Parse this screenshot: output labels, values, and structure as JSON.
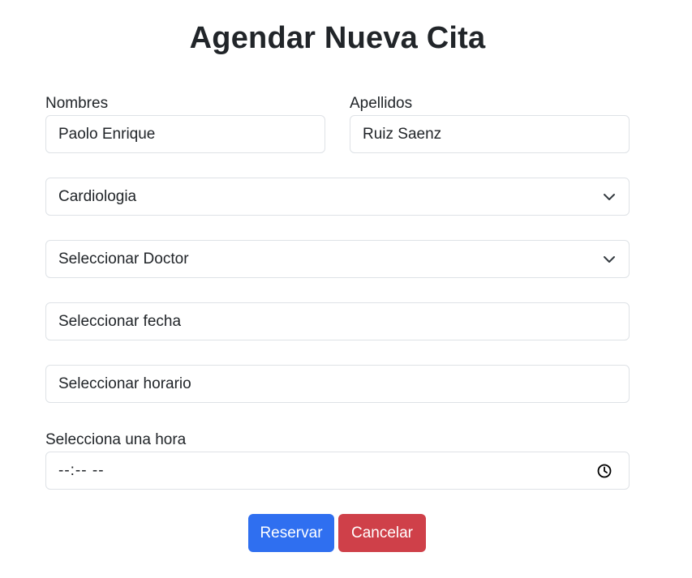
{
  "title": "Agendar Nueva Cita",
  "form": {
    "nombres": {
      "label": "Nombres",
      "value": "Paolo Enrique"
    },
    "apellidos": {
      "label": "Apellidos",
      "value": "Ruiz Saenz"
    },
    "especialidad": {
      "selected": "Cardiologia",
      "icon": "chevron-down-icon"
    },
    "doctor": {
      "selected": "Seleccionar Doctor",
      "icon": "chevron-down-icon"
    },
    "fecha": {
      "placeholder": "Seleccionar fecha"
    },
    "horario": {
      "placeholder": "Seleccionar horario"
    },
    "hora": {
      "label": "Selecciona una hora",
      "value": "--:-- --",
      "icon": "clock-icon"
    }
  },
  "buttons": {
    "reservar": "Reservar",
    "cancelar": "Cancelar"
  },
  "colors": {
    "primary": "#2f6ff0",
    "danger": "#cf4049",
    "border": "#dee2e6",
    "text": "#212529"
  }
}
